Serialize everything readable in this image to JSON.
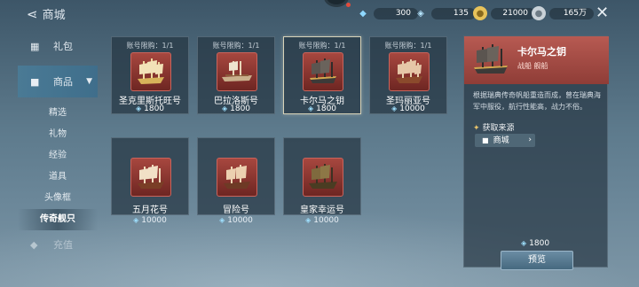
{
  "topbar": {
    "title": "商城",
    "back_icon": "back-arrow-icon"
  },
  "currencies": [
    {
      "icon": "diamond-icon",
      "color": "#8fd8ff",
      "value": "300"
    },
    {
      "icon": "gem-icon",
      "color": "#b7e6ff",
      "value": "135"
    },
    {
      "icon": "gold-coin-icon",
      "color": "#e7c25a",
      "value": "21000"
    },
    {
      "icon": "silver-coin-icon",
      "color": "#c9d2d8",
      "value": "165万"
    }
  ],
  "sidebar": {
    "gift_label": "礼包",
    "shop_label": "商品",
    "sub_items": [
      "精选",
      "礼物",
      "经验",
      "道具",
      "头像框",
      "传奇舰只"
    ],
    "recharge_label": "充值"
  },
  "cards": [
    {
      "limit": "账号限购：1/1",
      "name": "圣克里斯托旺号",
      "price": "1800"
    },
    {
      "limit": "账号限购：1/1",
      "name": "巴拉洛斯号",
      "price": "1800"
    },
    {
      "limit": "账号限购：1/1",
      "name": "卡尔马之钥",
      "price": "1800"
    },
    {
      "limit": "账号限购：1/1",
      "name": "圣玛丽亚号",
      "price": "10000"
    },
    {
      "name": "五月花号",
      "price": "10000"
    },
    {
      "name": "冒险号",
      "price": "10000"
    },
    {
      "name": "皇家幸运号",
      "price": "10000"
    }
  ],
  "detail": {
    "title": "卡尔马之钥",
    "tags": "战船  舰船",
    "description": "根据瑞典传奇帆船重造而成，曾在瑞典海军中服役，航行性能高，战力不俗。",
    "source_label": "获取来源",
    "source_shop": "商城",
    "price": "1800",
    "preview_label": "预览"
  }
}
